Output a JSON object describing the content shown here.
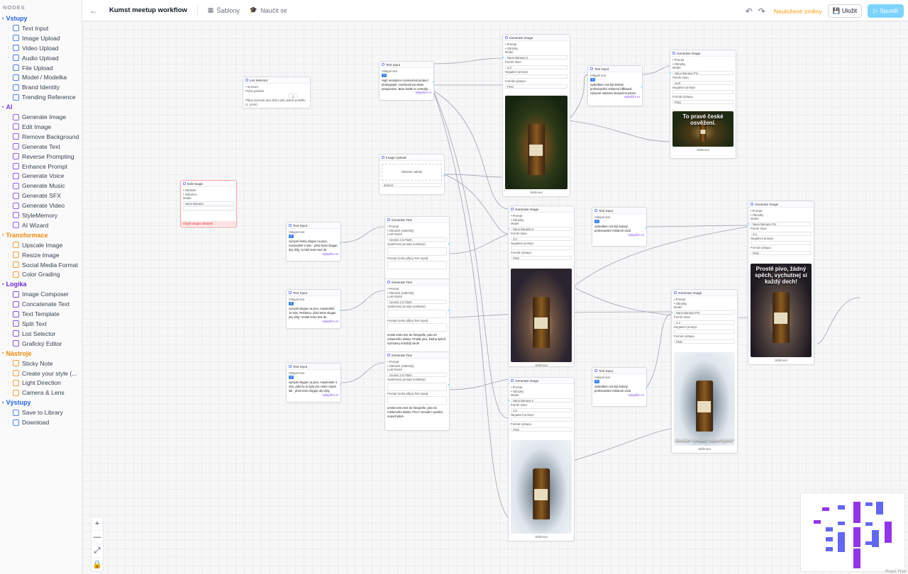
{
  "sidebar": {
    "title": "NODES",
    "sections": [
      {
        "label": "Vstupy",
        "color": "#2563eb",
        "items": [
          {
            "label": "Text Input",
            "icon": "text-icon"
          },
          {
            "label": "Image Upload",
            "icon": "image-icon"
          },
          {
            "label": "Video Upload",
            "icon": "video-icon"
          },
          {
            "label": "Audio Upload",
            "icon": "headphones-icon"
          },
          {
            "label": "File Upload",
            "icon": "file-icon"
          },
          {
            "label": "Model / Modelka",
            "icon": "person-icon"
          },
          {
            "label": "Brand Identity",
            "icon": "brand-icon"
          },
          {
            "label": "Trending Reference",
            "icon": "trending-icon"
          }
        ]
      },
      {
        "label": "AI",
        "color": "#7c3aed",
        "items": [
          {
            "label": "Generate Image",
            "icon": "sparkle-icon"
          },
          {
            "label": "Edit Image",
            "icon": "edit-icon"
          },
          {
            "label": "Remove Background",
            "icon": "scissors-icon"
          },
          {
            "label": "Generate Text",
            "icon": "text-gen-icon"
          },
          {
            "label": "Reverse Prompting",
            "icon": "reverse-icon"
          },
          {
            "label": "Enhance Prompt",
            "icon": "wand-icon"
          },
          {
            "label": "Generate Voice",
            "icon": "waveform-icon"
          },
          {
            "label": "Generate Music",
            "icon": "music-icon"
          },
          {
            "label": "Generate SFX",
            "icon": "sfx-icon"
          },
          {
            "label": "Generate Video",
            "icon": "film-icon"
          },
          {
            "label": "StyleMemory",
            "icon": "memory-icon"
          },
          {
            "label": "AI Wizard",
            "icon": "wizard-icon"
          }
        ]
      },
      {
        "label": "Transformace",
        "color": "#ea8a0c",
        "items": [
          {
            "label": "Upscale Image",
            "icon": "upscale-icon"
          },
          {
            "label": "Resize Image",
            "icon": "resize-icon"
          },
          {
            "label": "Social Media Format",
            "icon": "grid-icon"
          },
          {
            "label": "Color Grading",
            "icon": "palette-icon"
          }
        ]
      },
      {
        "label": "Logika",
        "color": "#6d28d9",
        "items": [
          {
            "label": "Image Composer",
            "icon": "layers-icon"
          },
          {
            "label": "Concatenate Text",
            "icon": "link-icon"
          },
          {
            "label": "Text Template",
            "icon": "braces-icon"
          },
          {
            "label": "Split Text",
            "icon": "split-icon"
          },
          {
            "label": "List Selector",
            "icon": "list-icon"
          },
          {
            "label": "Grafický Editor",
            "icon": "editor-icon"
          }
        ]
      },
      {
        "label": "Nástroje",
        "color": "#ea8a0c",
        "items": [
          {
            "label": "Sticky Note",
            "icon": "note-icon"
          },
          {
            "label": "Create your style (...",
            "icon": "style-icon"
          },
          {
            "label": "Light Direction",
            "icon": "bulb-icon"
          },
          {
            "label": "Camera & Lens",
            "icon": "camera-icon"
          }
        ]
      },
      {
        "label": "Výstupy",
        "color": "#2563eb",
        "items": [
          {
            "label": "Save to Library",
            "icon": "library-icon"
          },
          {
            "label": "Download",
            "icon": "download-icon"
          }
        ]
      }
    ]
  },
  "topbar": {
    "title": "Kumst meetup workflow",
    "templates": "Šablony",
    "learn": "Naučit se",
    "unsaved": "Neuložené změny",
    "save": "Uložit",
    "run": "Spustit"
  },
  "nodes": {
    "list_selector": {
      "title": "List Selector",
      "l1": "• Seznam",
      "l2": "Počet položek",
      "value": "1",
      "note": "Připoj Seznam (text list) k jeho položí položku (1. první)."
    },
    "edit_image": {
      "title": "Edit Image",
      "l1": "• Obrázek",
      "l2": "• Instrukce",
      "model_label": "Model",
      "model": "Nano Banana",
      "error": "Chybí vstupní obrázek"
    },
    "text_input_1": {
      "title": "Text Input",
      "label": "Vstupní text",
      "text": "High resolution commercial product photograph, overhead top-down perspective. Beer bottle is centrally...",
      "action": "Vylepšit s AI"
    },
    "image_upload": {
      "title": "Image Upload",
      "drop": "Obrázek nahrán",
      "clear": "Změnit"
    },
    "gen_image_1": {
      "title": "Generate Image",
      "l1": "• Prompt",
      "l2": "• Obrázky",
      "model_label": "Model",
      "model": "Nano Banana 2",
      "ratio_label": "Poměr stran",
      "ratio": "2:3",
      "neg_label": "Negativní prompt",
      "fmt_label": "Formát výstupu",
      "fmt": "PNG",
      "download": "Stáhnout"
    },
    "text_input_2": {
      "title": "Text Input",
      "label": "Vstupní text",
      "text": "vysledkem má být krásný profesionální reklamní billboard. Výrazné reklamní bezpečné písmo.",
      "action": "Vylepšit s AI"
    },
    "gen_image_2": {
      "title": "Generate Image",
      "l1": "• Prompt",
      "l2": "• Obrázky",
      "model_label": "Model",
      "model": "Nano Banana Pro",
      "ratio_label": "Poměr stran",
      "ratio": "16:9",
      "neg_label": "Negativní prompt",
      "fmt_label": "Formát výstupu",
      "fmt": "PNG",
      "caption": "To pravé české osvěžení.",
      "download": "Stáhnout"
    },
    "text_input_3": {
      "title": "Text Input",
      "label": "Vstupní text",
      "text": "vymysli český slogan na pivo, maximálně 5 slov - před tento slogan dej vždy \"umísti tento text do fotografie\"",
      "action": "Vylepšit s AI"
    },
    "gen_text_1": {
      "title": "Generate Text",
      "l1": "• Prompt",
      "l2": "• Obrázek (volitelný)",
      "model_label": "LLM Model",
      "model": "Gemini 2.5 Flash",
      "sys_label": "Systémový prompt (volitelný)",
      "ctx_label": "Prompt (nebo připoj Text Input)"
    },
    "gen_image_3": {
      "title": "Generate Image",
      "l1": "• Prompt",
      "l2": "• Obrázky",
      "model_label": "Model",
      "model": "Nano Banana 2",
      "ratio_label": "Poměr stran",
      "ratio": "2:3",
      "neg_label": "Negativní prompt",
      "fmt_label": "Formát výstupu",
      "fmt": "PNG",
      "download": "Stáhnout"
    },
    "text_input_4": {
      "title": "Text Input",
      "label": "Vstupní text",
      "text": "vysledkem má být krásný profesionální reklamní vizál.",
      "action": "Vylepšit s AI"
    },
    "gen_image_4": {
      "title": "Generate Image",
      "l1": "• Prompt",
      "l2": "• Obrázky",
      "model_label": "Model",
      "model": "Nano Banana Pro",
      "ratio_label": "Poměr stran",
      "ratio": "2:3",
      "neg_label": "Negativní prompt",
      "fmt_label": "Formát výstupu",
      "fmt": "PNG",
      "caption": "Prostě pivo, žádný spěch, vychutnej si každý dech!",
      "download": "Stáhnout"
    },
    "text_input_5": {
      "title": "Text Input",
      "label": "Vstupní text",
      "text": "vymysli slogan na pivo, maximálně 10 slov. Reklamu. před tento slogan dej vždy \"umísti tento text do fotografie\"",
      "action": "Vylepšit s AI"
    },
    "gen_text_2": {
      "title": "Generate Text",
      "l1": "• Prompt",
      "l2": "• Obrázek (volitelný)",
      "model_label": "LLM Model",
      "model": "Gemini 2.5 Flash",
      "sys_label": "Systémový prompt (volitelný)",
      "ctx_label": "Prompt (nebo připoj Text Input)",
      "output": "umísti tento text do fotografie, jako do reklamního letáku: Prostě pivo, žádný spěch, vychutnej si každý dech!"
    },
    "gen_image_5": {
      "title": "Generate Image",
      "l1": "• Prompt",
      "l2": "• Obrázky",
      "model_label": "Model",
      "model": "Nano Banana Pro",
      "ratio_label": "Poměr stran",
      "ratio": "2:3",
      "neg_label": "Negativní prompt",
      "fmt_label": "Formát výstupu",
      "fmt": "PNG",
      "caption": "Geniální vynález, nepochybně!",
      "download": "Stáhnout"
    },
    "text_input_6": {
      "title": "Text Input",
      "label": "Vstupní text",
      "text": "vymysli slogan na pivo, maximálně 3 slov, jaké by to bylo pro velmi chytré lidi - před tento slogan dej vždy \"umísti tento text do fotografie\"",
      "action": "Vylepšit s AI"
    },
    "gen_text_3": {
      "title": "Generate Text",
      "l1": "• Prompt",
      "l2": "• Obrázek (volitelný)",
      "model_label": "LLM Model",
      "model": "Gemini 2.5 Flash",
      "sys_label": "Systémový prompt (volitelný)",
      "ctx_label": "Prompt (nebo připoj Text Input)",
      "output": "umísti tento text do fotografie, jako do reklamního letáku: Pivo? Geniální vynález, nepochybně."
    },
    "gen_image_6": {
      "title": "Generate Image",
      "l1": "• Prompt",
      "l2": "• Obrázky",
      "model_label": "Model",
      "model": "Nano Banana 2",
      "ratio_label": "Poměr stran",
      "ratio": "2:3",
      "neg_label": "Negativní prompt",
      "fmt_label": "Formát výstupu",
      "fmt": "PNG",
      "download": "Stáhnout"
    },
    "text_input_7": {
      "title": "Text Input",
      "label": "Vstupní text",
      "text": "vysledkem má být krásný profesionální reklamní vizál.",
      "action": "Vylepšit s AI"
    }
  },
  "canvas_controls": {
    "zoom_in": "+",
    "zoom_out": "—",
    "fit": "⤢",
    "lock": "🔒"
  },
  "credit": "React Flow"
}
